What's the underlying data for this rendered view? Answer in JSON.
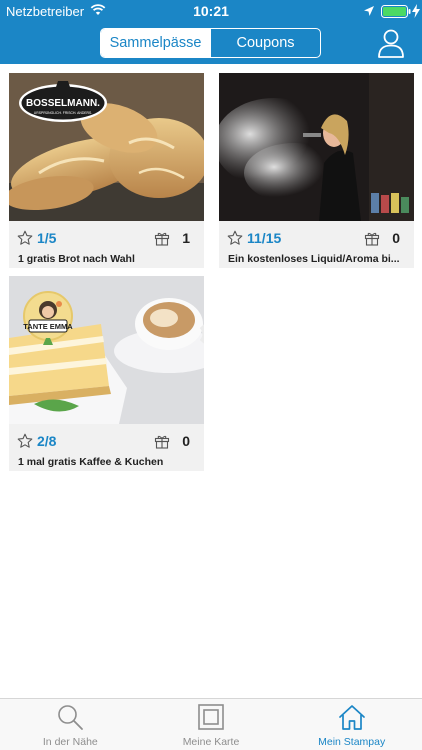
{
  "status_bar": {
    "carrier": "Netzbetreiber",
    "time": "10:21"
  },
  "segmented": {
    "items": [
      "Sammelpässe",
      "Coupons"
    ],
    "selected": "Sammelpässe"
  },
  "colors": {
    "brand": "#1b86c6",
    "battery": "#4cd964"
  },
  "cards": [
    {
      "stamps": "1/5",
      "rewards": "1",
      "title": "1 gratis Brot nach Wahl",
      "logo_text": "BOSSELMANN.",
      "logo_sub": "URSPRÜNGLICH. FRISCH. ANDERS."
    },
    {
      "stamps": "11/15",
      "rewards": "0",
      "title": "Ein kostenloses Liquid/Aroma bi..."
    },
    {
      "stamps": "2/8",
      "rewards": "0",
      "title": "1 mal gratis Kaffee & Kuchen",
      "logo_text": "TANTE EMMA"
    }
  ],
  "tabbar": {
    "items": [
      {
        "label": "In der Nähe",
        "icon": "search-icon"
      },
      {
        "label": "Meine Karte",
        "icon": "card-frame-icon"
      },
      {
        "label": "Mein Stampay",
        "icon": "home-icon"
      }
    ],
    "active": "Mein Stampay"
  }
}
